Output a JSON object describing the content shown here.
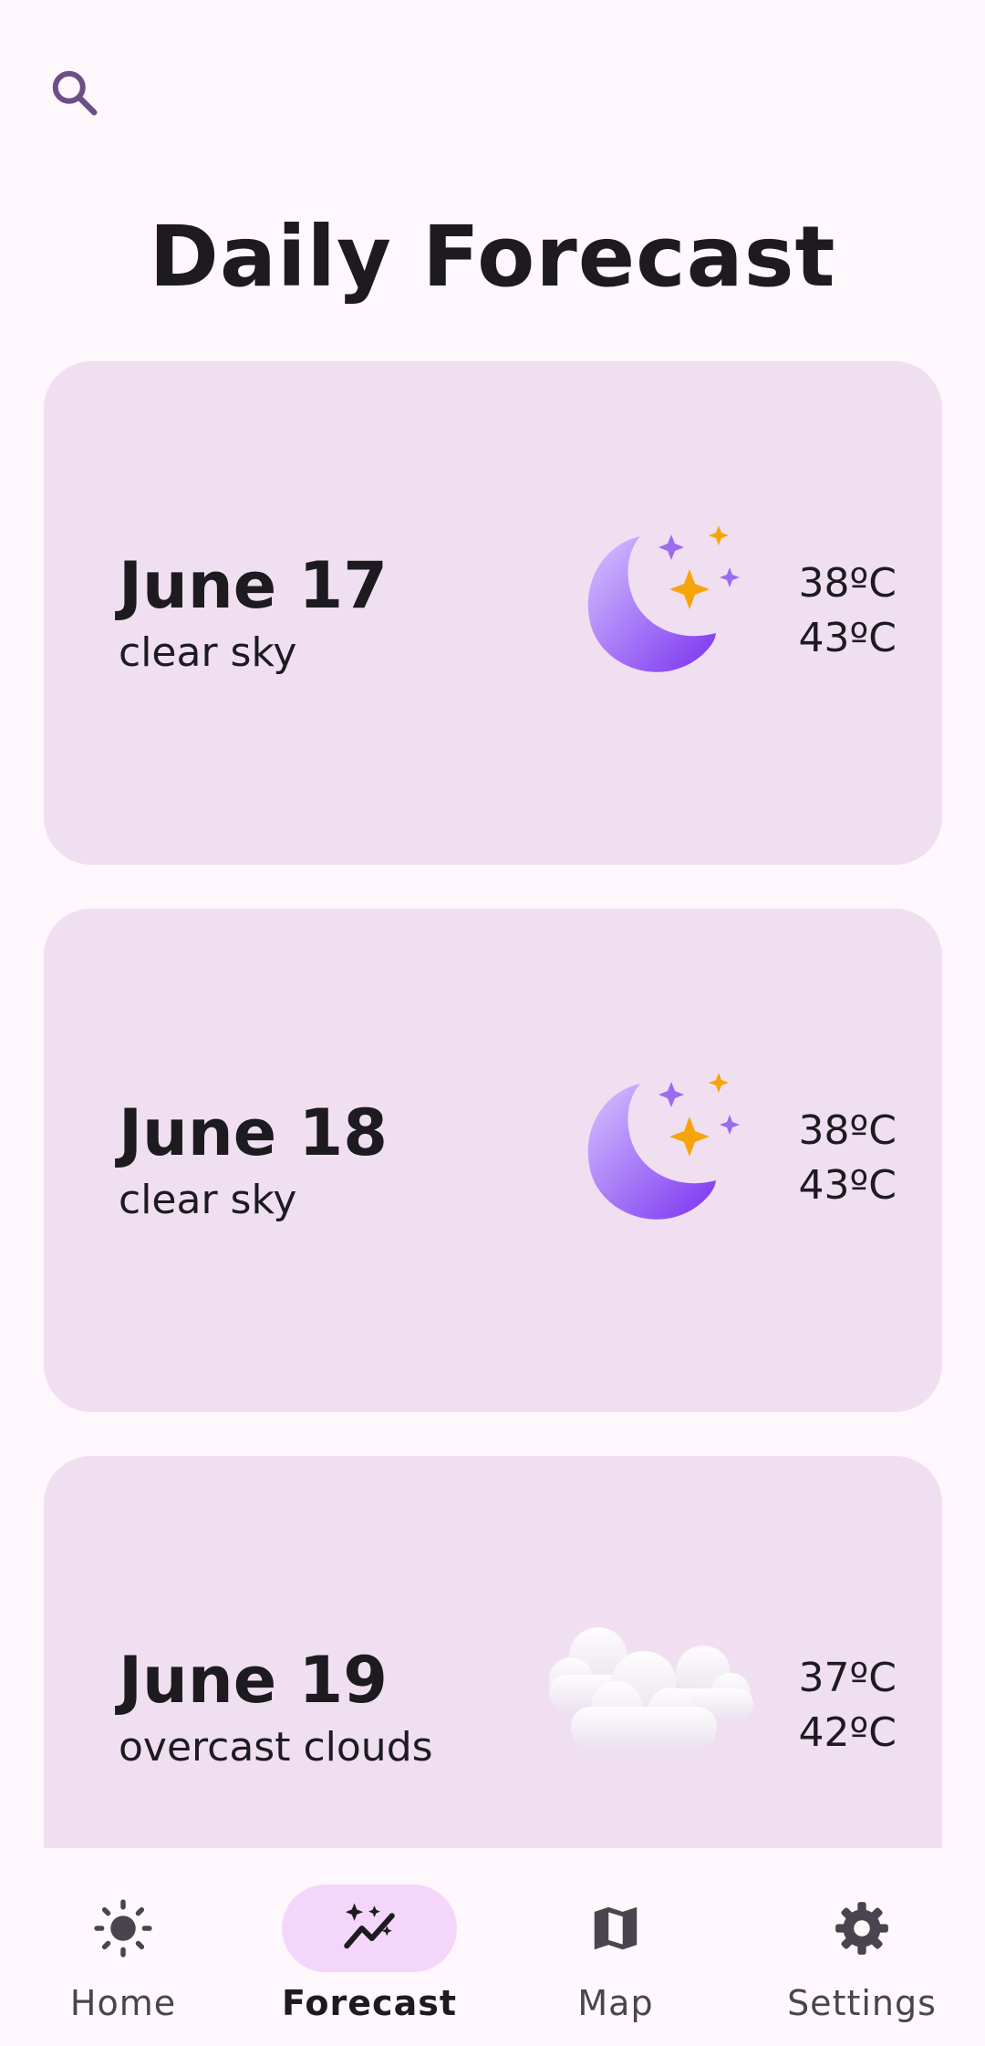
{
  "header": {
    "search_icon": "search-icon",
    "title": "Daily Forecast"
  },
  "forecast": [
    {
      "date": "June 17",
      "description": "clear sky",
      "icon": "moon-stars-icon",
      "temp_min": "38ºC",
      "temp_max": "43ºC"
    },
    {
      "date": "June 18",
      "description": "clear sky",
      "icon": "moon-stars-icon",
      "temp_min": "38ºC",
      "temp_max": "43ºC"
    },
    {
      "date": "June 19",
      "description": "overcast clouds",
      "icon": "clouds-icon",
      "temp_min": "37ºC",
      "temp_max": "42ºC"
    }
  ],
  "nav": {
    "items": [
      {
        "label": "Home",
        "icon": "sun-icon",
        "active": false
      },
      {
        "label": "Forecast",
        "icon": "sparkle-trend-icon",
        "active": true
      },
      {
        "label": "Map",
        "icon": "map-icon",
        "active": false
      },
      {
        "label": "Settings",
        "icon": "gear-icon",
        "active": false
      }
    ]
  },
  "colors": {
    "background": "#fef7fb",
    "card": "#f0dff1",
    "active_pill": "#f5d6fb",
    "search_icon": "#6d4f86",
    "moon": "#8a4bf2",
    "star_gold": "#f5a50a"
  }
}
